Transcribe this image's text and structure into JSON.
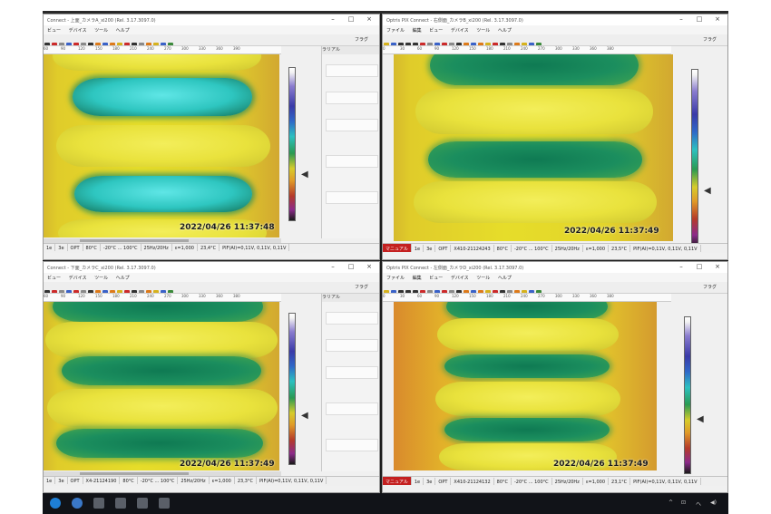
{
  "windows": {
    "tl": {
      "title": "Connect - 上面_カメラA_xi200 (Rel. 3.17.3097.0)",
      "menu": [
        "ビュー",
        "デバイス",
        "ツール",
        "ヘルプ"
      ],
      "flag": "フラグ",
      "timestamp": "2022/04/26 11:37:48",
      "status": [
        "1e",
        "3e",
        "OPT",
        "80°C",
        "-20°C ... 100°C",
        "25Hz/20Hz",
        "ε=1,000",
        "23,4°C",
        "PIF(AI)=0,11V, 0,11V, 0,11V"
      ],
      "ruler": [
        "60",
        "90",
        "120",
        "150",
        "180",
        "210",
        "240",
        "270",
        "300",
        "330",
        "360",
        "390"
      ],
      "panel_header": "ラリアル"
    },
    "tr": {
      "title": "Optris PIX Connect - 右側面_カメラB_xi200 (Rel. 3.17.3097.0)",
      "menu": [
        "ファイル",
        "編集",
        "ビュー",
        "デバイス",
        "ツール",
        "ヘルプ"
      ],
      "flag": "フラグ",
      "timestamp": "2022/04/26 11:37:49",
      "status": [
        "マニュアル",
        "1e",
        "3e",
        "OPT",
        "X410-21124243",
        "80°C",
        "-20°C ... 100°C",
        "25Hz/20Hz",
        "ε=1,000",
        "23,5°C",
        "PIF(AI)=0,11V, 0,11V, 0,11V"
      ],
      "ruler": [
        "0",
        "30",
        "60",
        "90",
        "120",
        "150",
        "180",
        "210",
        "240",
        "270",
        "300",
        "330",
        "360",
        "380"
      ],
      "panel_header": ""
    },
    "bl": {
      "title": "Connect - 下面_カメラC_xi200 (Rel. 3.17.3097.0)",
      "menu": [
        "ビュー",
        "デバイス",
        "ツール",
        "ヘルプ"
      ],
      "flag": "フラグ",
      "timestamp": "2022/04/26 11:37:49",
      "status": [
        "1e",
        "3e",
        "OPT",
        "X4-21124190",
        "80°C",
        "-20°C ... 100°C",
        "25Hz/20Hz",
        "ε=1,000",
        "23,3°C",
        "PIF(AI)=0,11V, 0,11V, 0,11V"
      ],
      "ruler": [
        "60",
        "90",
        "120",
        "150",
        "180",
        "210",
        "240",
        "270",
        "300",
        "330",
        "360",
        "380"
      ],
      "panel_header": "ラリアル"
    },
    "br": {
      "title": "Optris PIX Connect - 左側面_カメラD_xi200 (Rel. 3.17.3097.0)",
      "menu": [
        "ファイル",
        "編集",
        "ビュー",
        "デバイス",
        "ツール",
        "ヘルプ"
      ],
      "flag": "フラグ",
      "timestamp": "2022/04/26 11:37:49",
      "status": [
        "マニュアル",
        "1e",
        "3e",
        "OPT",
        "X410-21124132",
        "80°C",
        "-20°C ... 100°C",
        "25Hz/20Hz",
        "ε=1,000",
        "23,1°C",
        "PIF(AI)=0,11V, 0,11V, 0,11V"
      ],
      "ruler": [
        "0",
        "30",
        "60",
        "90",
        "120",
        "150",
        "180",
        "210",
        "240",
        "270",
        "300",
        "330",
        "360",
        "380"
      ],
      "panel_header": ""
    }
  },
  "colors": {
    "thermal_hot": "#e6dd2a",
    "thermal_cyan": "#2ec6c0",
    "thermal_green": "#1b8e5e",
    "warn_red": "#c42020"
  },
  "icons": [
    "file-open-icon",
    "save-icon",
    "play-icon",
    "record-icon",
    "camera-icon",
    "color-palette-icon",
    "tools-icon",
    "flag-icon"
  ],
  "taskbar": {
    "icons": [
      "edge-icon",
      "app-icon",
      "window-icon",
      "window-icon",
      "window-icon",
      "window-icon"
    ],
    "tray": [
      "^",
      "⊡",
      "ヘ",
      "◀)"
    ]
  }
}
